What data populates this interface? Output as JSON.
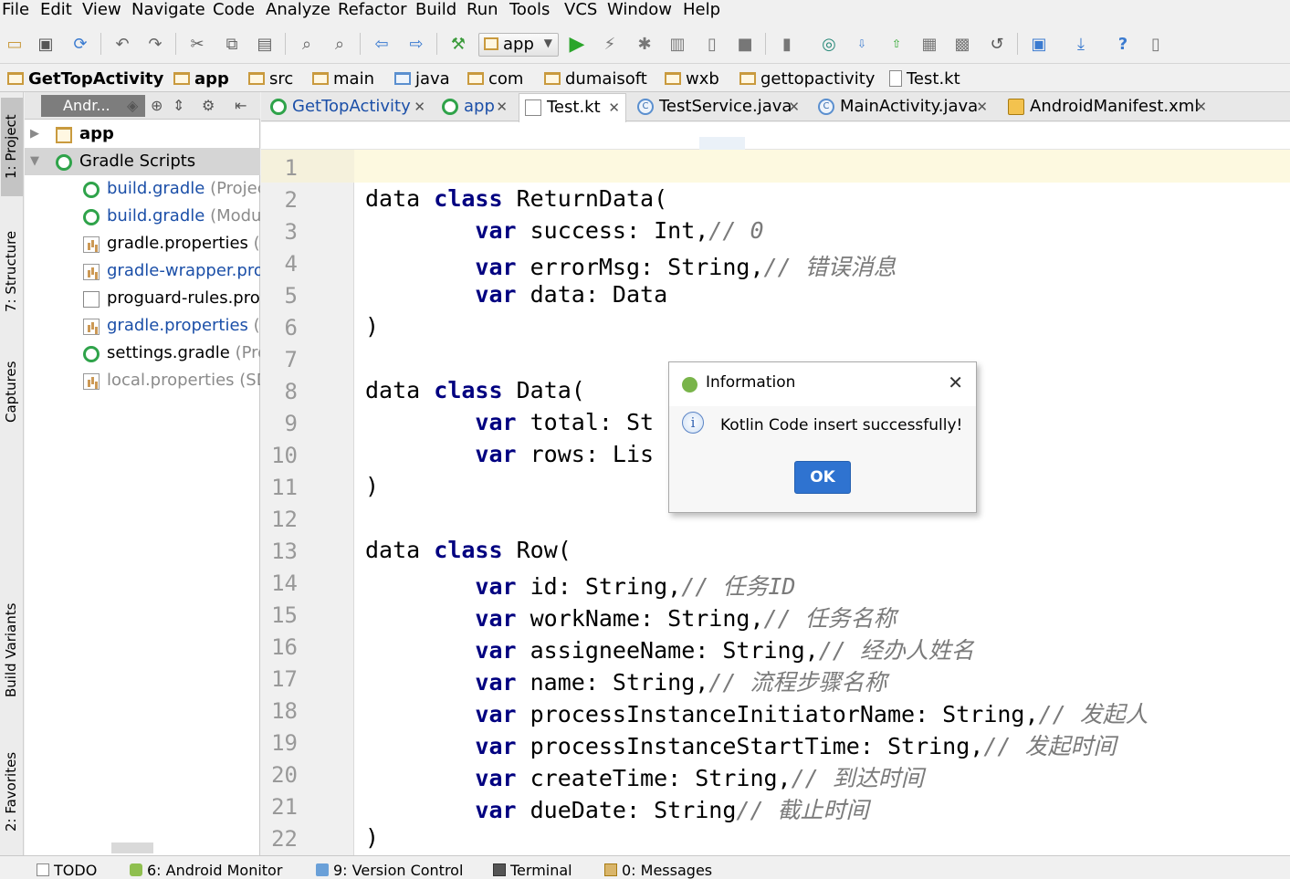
{
  "menu": [
    "File",
    "Edit",
    "View",
    "Navigate",
    "Code",
    "Analyze",
    "Refactor",
    "Build",
    "Run",
    "Tools",
    "VCS",
    "Window",
    "Help"
  ],
  "toolbar": {
    "run_config": "app"
  },
  "breadcrumbs": [
    "GetTopActivity",
    "app",
    "src",
    "main",
    "java",
    "com",
    "dumaisoft",
    "wxb",
    "gettopactivity",
    "Test.kt"
  ],
  "left_tabs": {
    "project": "1: Project",
    "structure": "7: Structure",
    "captures": "Captures",
    "build_variants": "Build Variants",
    "favorites": "2: Favorites"
  },
  "project_panel": {
    "mode": "Andr...",
    "items": [
      {
        "label": "app",
        "hint": ""
      },
      {
        "label": "Gradle Scripts",
        "hint": ""
      },
      {
        "label": "build.gradle",
        "hint": " (Project"
      },
      {
        "label": "build.gradle",
        "hint": " (Modul"
      },
      {
        "label": "gradle.properties",
        "hint": " (G"
      },
      {
        "label": "gradle-wrapper.prop",
        "hint": ""
      },
      {
        "label": "proguard-rules.pro",
        "hint": " ("
      },
      {
        "label": "gradle.properties",
        "hint": " (P"
      },
      {
        "label": "settings.gradle",
        "hint": " (Proj"
      },
      {
        "label": "local.properties",
        "hint": " (SDI"
      }
    ]
  },
  "editor_tabs": [
    {
      "label": "GetTopActivity"
    },
    {
      "label": "app"
    },
    {
      "label": "Test.kt"
    },
    {
      "label": "TestService.java"
    },
    {
      "label": "MainActivity.java"
    },
    {
      "label": "AndroidManifest.xml"
    }
  ],
  "line_numbers": [
    "1",
    "2",
    "3",
    "4",
    "5",
    "6",
    "7",
    "8",
    "9",
    "10",
    "11",
    "12",
    "13",
    "14",
    "15",
    "16",
    "17",
    "18",
    "19",
    "20",
    "21",
    "22"
  ],
  "code": {
    "kw_data": "data",
    "kw_class": "class",
    "kw_var": "var",
    "l2": " ReturnData(",
    "l3": " success: Int,",
    "l3c": "// 0",
    "l4": " errorMsg: String,",
    "l4c": "// 错误消息",
    "l5": " data: Data",
    "paren": ")",
    "l8": " Data(",
    "l9": " total: St",
    "l10": " rows: Lis",
    "l13": " Row(",
    "l14": " id: String,",
    "l14c": "// 任务ID",
    "l15": " workName: String,",
    "l15c": "// 任务名称",
    "l16": " assigneeName: String,",
    "l16c": "// 经办人姓名",
    "l17": " name: String,",
    "l17c": "// 流程步骤名称",
    "l18": " processInstanceInitiatorName: String,",
    "l18c": "// 发起人",
    "l19": " processInstanceStartTime: String,",
    "l19c": "// 发起时间",
    "l20": " createTime: String,",
    "l20c": "// 到达时间",
    "l21": " dueDate: String",
    "l21c": "// 截止时间"
  },
  "dialog": {
    "title": "Information",
    "message": "Kotlin Code insert successfully!",
    "ok": "OK"
  },
  "status_tabs": [
    "TODO",
    "6: Android Monitor",
    "9: Version Control",
    "Terminal",
    "0: Messages"
  ]
}
